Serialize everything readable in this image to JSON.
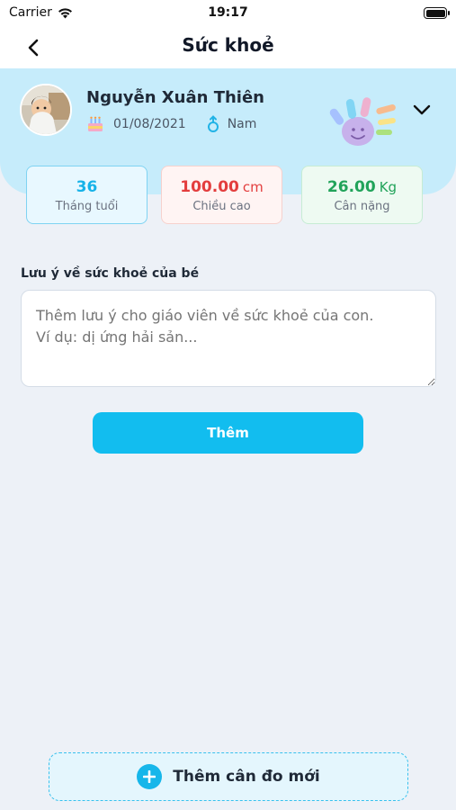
{
  "status_bar": {
    "carrier": "Carrier",
    "time": "19:17"
  },
  "navbar": {
    "title": "Sức khoẻ"
  },
  "profile": {
    "name": "Nguyễn Xuân Thiên",
    "birthday": "01/08/2021",
    "gender": "Nam"
  },
  "stats": {
    "age": {
      "value": "36",
      "label": "Tháng tuổi"
    },
    "height": {
      "value": "100.00",
      "unit": "cm",
      "label": "Chiều cao"
    },
    "weight": {
      "value": "26.00",
      "unit": "Kg",
      "label": "Cân nặng"
    }
  },
  "note": {
    "label": "Lưu ý về sức khoẻ của bé",
    "placeholder": "Thêm lưu ý cho giáo viên về sức khoẻ của con.\nVí dụ: dị ứng hải sản..."
  },
  "add_button": {
    "label": "Thêm"
  },
  "new_measure_button": {
    "label": "Thêm cân đo mới"
  },
  "colors": {
    "accent": "#12bdef",
    "profile_band": "#c6ecfb",
    "height": "#e33d3d",
    "weight": "#21a35a",
    "background": "#edf1f7"
  },
  "icons": [
    "wifi-icon",
    "battery-icon",
    "back-arrow-icon",
    "birthday-cake-icon",
    "gender-icon",
    "chevron-down-icon",
    "handprint-icon",
    "plus-icon"
  ]
}
